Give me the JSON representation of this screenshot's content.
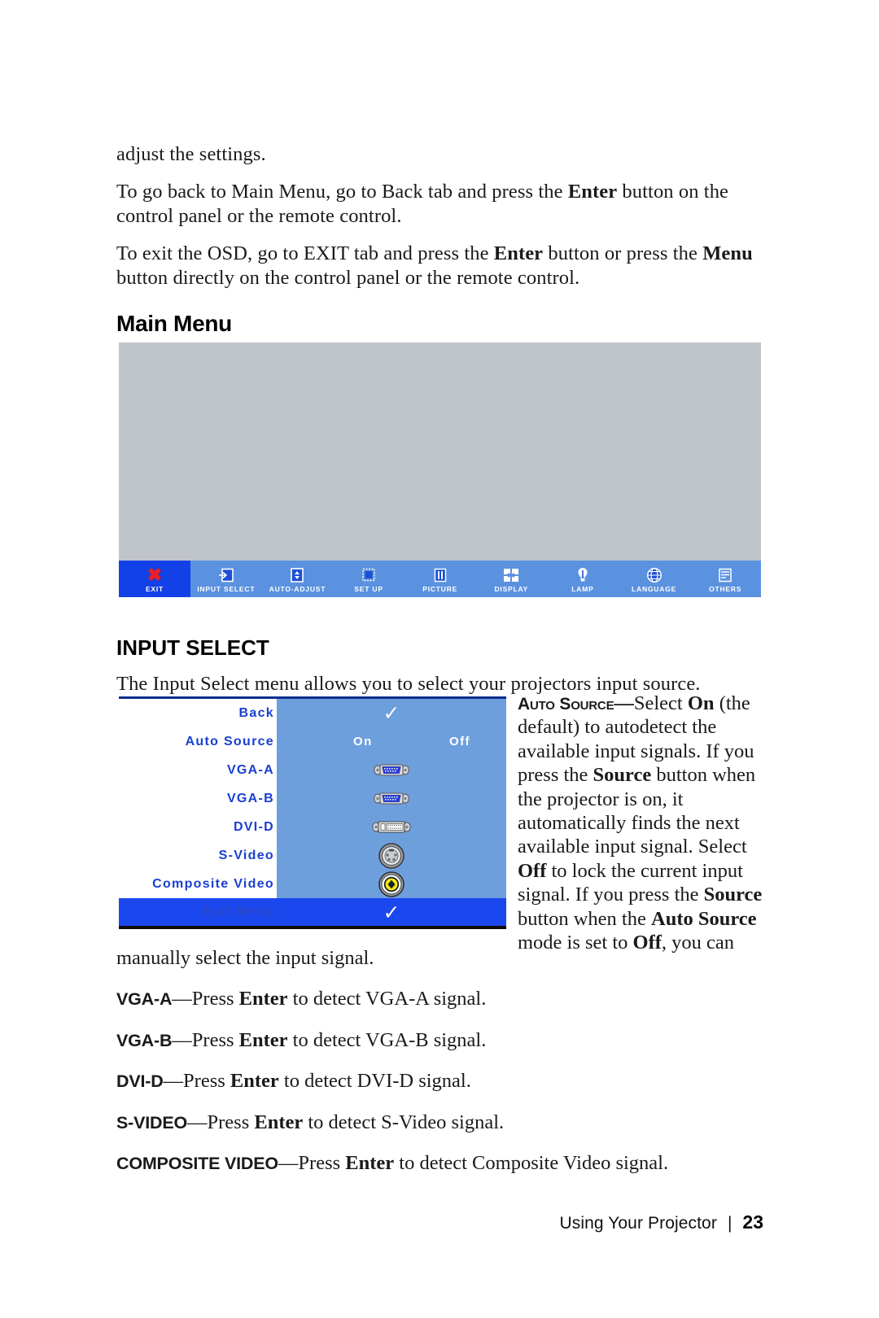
{
  "intro": {
    "p1": "adjust the settings.",
    "p2_a": "To go back to Main Menu, go to Back tab and press the ",
    "p2_b": "Enter",
    "p2_c": " button on the control panel or the remote control.",
    "p3_a": "To exit the OSD, go to EXIT tab and press the ",
    "p3_b": "Enter",
    "p3_c": " button or press the ",
    "p3_d": "Menu",
    "p3_e": " button directly on the control panel or the remote control."
  },
  "headings": {
    "main_menu": "Main Menu",
    "input_select": "INPUT SELECT"
  },
  "main_menu_figure": {
    "items": [
      {
        "label": "EXIT",
        "icon": "red-x-icon",
        "selected": true
      },
      {
        "label": "INPUT SELECT",
        "icon": "input-select-icon",
        "selected": false
      },
      {
        "label": "AUTO-ADJUST",
        "icon": "auto-adjust-icon",
        "selected": false
      },
      {
        "label": "SET UP",
        "icon": "set-up-icon",
        "selected": false
      },
      {
        "label": "PICTURE",
        "icon": "picture-icon",
        "selected": false
      },
      {
        "label": "DISPLAY",
        "icon": "display-icon",
        "selected": false
      },
      {
        "label": "LAMP",
        "icon": "lamp-icon",
        "selected": false
      },
      {
        "label": "LANGUAGE",
        "icon": "language-globe-icon",
        "selected": false
      },
      {
        "label": "OTHERS",
        "icon": "others-icon",
        "selected": false
      }
    ],
    "colors": {
      "screen_bg": "#c0c5cb",
      "bar_bg": "#5b92e0",
      "selected_bg": "#1341e8",
      "x_red": "#e8202a"
    }
  },
  "input_select_intro": "The Input Select menu allows you to select your projectors input source.",
  "osd": {
    "rows": [
      {
        "label": "Back",
        "value": "",
        "icon": "check-icon"
      },
      {
        "label": "Auto Source",
        "value_on": "On",
        "value_off": "Off",
        "icon": ""
      },
      {
        "label": "VGA-A",
        "value": "",
        "icon": "vga-connector-icon"
      },
      {
        "label": "VGA-B",
        "value": "",
        "icon": "vga-connector-icon"
      },
      {
        "label": "DVI-D",
        "value": "",
        "icon": "dvi-connector-icon"
      },
      {
        "label": "S-Video",
        "value": "",
        "icon": "svideo-connector-icon"
      },
      {
        "label": "Composite Video",
        "value": "",
        "icon": "composite-connector-icon"
      }
    ],
    "exit_row": {
      "label": "Exit Menu",
      "icon": "check-icon"
    },
    "colors": {
      "label_blue": "#1a3fd0",
      "panel_blue": "#6e9fdd",
      "highlight_blue": "#1a47ee",
      "top_rule": "#0b2f8f"
    }
  },
  "side_text": {
    "term": "Auto Source",
    "dash": "—",
    "t1": "Select ",
    "b1": "On",
    "t2": " (the default) to autodetect the available input signals. If you press the ",
    "b2": "Source",
    "t3": " button when the projector is on, it automatically finds the next available input signal. Select ",
    "b3": "Off",
    "t4": " to lock the current input signal. If you press the ",
    "b4": "Source",
    "t5": " button when the ",
    "b5": "Auto Source",
    "t6": " mode is set to ",
    "b6": "Off",
    "t7": ", you can"
  },
  "lower": {
    "p_manual": "manually select the input signal.",
    "items": [
      {
        "term": "VGA-A",
        "sc": "",
        "rest_a": "—Press ",
        "bold": "Enter",
        "rest_b": " to detect VGA-A signal."
      },
      {
        "term": "VGA-B",
        "sc": "",
        "rest_a": "—Press ",
        "bold": "Enter",
        "rest_b": " to detect VGA-B signal."
      },
      {
        "term": "DVI-D",
        "sc": "",
        "rest_a": "—Press ",
        "bold": "Enter",
        "rest_b": " to detect DVI-D signal."
      },
      {
        "term": "S-V",
        "sc": "IDEO",
        "rest_a": "—Press ",
        "bold": "Enter",
        "rest_b": " to detect S-Video signal."
      },
      {
        "term": "C",
        "sc": "OMPOSITE V",
        "term2": "",
        "rest_a": "—Press ",
        "bold": "Enter",
        "rest_b": " to detect Composite Video signal."
      }
    ],
    "composite_full_a": "C",
    "composite_full_b": "OMPOSITE",
    "composite_full_c": " V",
    "composite_full_d": "IDEO",
    "svideo_a": "S-V",
    "svideo_b": "IDEO"
  },
  "footer": {
    "text": "Using Your Projector",
    "separator": "|",
    "page": "23"
  }
}
